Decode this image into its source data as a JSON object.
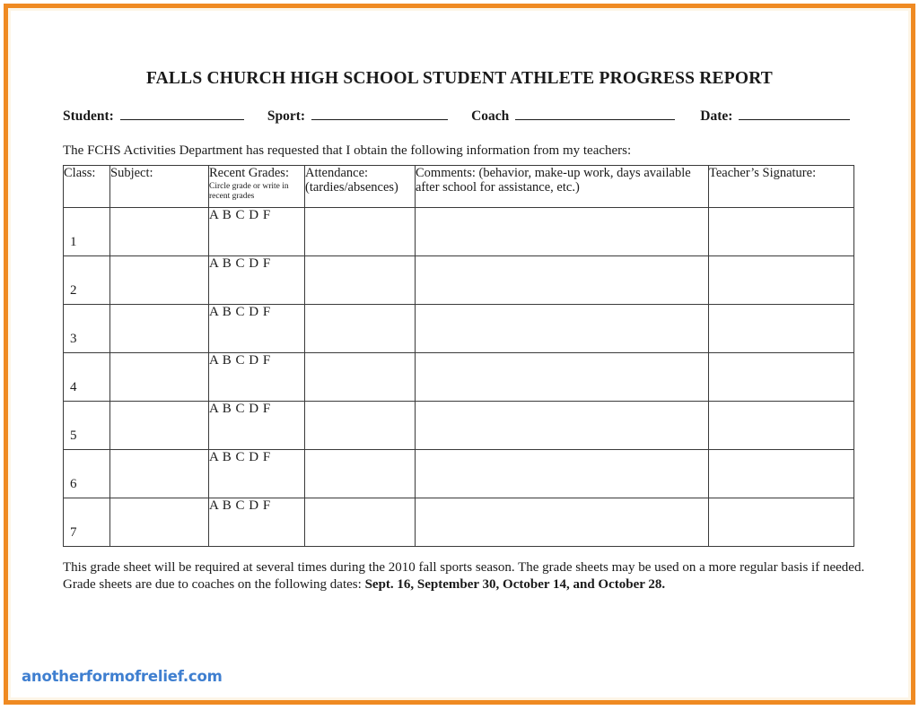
{
  "page": {
    "border_color": "#ef8a22",
    "background": "#ffffff"
  },
  "document": {
    "title": "FALLS CHURCH HIGH SCHOOL STUDENT ATHLETE PROGRESS REPORT",
    "intro": "The FCHS Activities Department has requested that I obtain the following information from my teachers:"
  },
  "identity_fields": {
    "student_label": "Student:",
    "sport_label": "Sport:",
    "coach_label": "Coach",
    "date_label": "Date:",
    "student_value": "",
    "sport_value": "",
    "coach_value": "",
    "date_value": ""
  },
  "table": {
    "headers": {
      "class": "Class:",
      "subject": "Subject:",
      "recent_grades": "Recent Grades:",
      "recent_grades_sub": "Circle grade or write in recent grades",
      "attendance": "Attendance:",
      "attendance_sub": "(tardies/absences)",
      "comments": "Comments: (behavior, make-up work, days available after school for assistance, etc.)",
      "signature": "Teacher’s Signature:"
    },
    "grade_options": "A  B C  D  F",
    "rows": [
      {
        "class": "1",
        "subject": "",
        "grades": "A  B C  D  F",
        "attendance": "",
        "comments": "",
        "signature": ""
      },
      {
        "class": "2",
        "subject": "",
        "grades": "A  B C  D  F",
        "attendance": "",
        "comments": "",
        "signature": ""
      },
      {
        "class": "3",
        "subject": "",
        "grades": "A  B C  D  F",
        "attendance": "",
        "comments": "",
        "signature": ""
      },
      {
        "class": "4",
        "subject": "",
        "grades": "A  B C  D  F",
        "attendance": "",
        "comments": "",
        "signature": ""
      },
      {
        "class": "5",
        "subject": "",
        "grades": "A  B C  D  F",
        "attendance": "",
        "comments": "",
        "signature": ""
      },
      {
        "class": "6",
        "subject": "",
        "grades": "A  B C  D  F",
        "attendance": "",
        "comments": "",
        "signature": ""
      },
      {
        "class": "7",
        "subject": "",
        "grades": "A  B C  D  F",
        "attendance": "",
        "comments": "",
        "signature": ""
      }
    ]
  },
  "footer": {
    "text_part1": "This grade sheet will be required at several times during the 2010 fall sports season. The grade sheets may be used on a more regular basis if needed.  Grade sheets are due to coaches on the following dates:  ",
    "dates_bold": "Sept. 16, September 30, October 14, and October 28."
  },
  "watermark": {
    "text": "anotherformofrelief.com",
    "color": "#3f7fd0"
  }
}
